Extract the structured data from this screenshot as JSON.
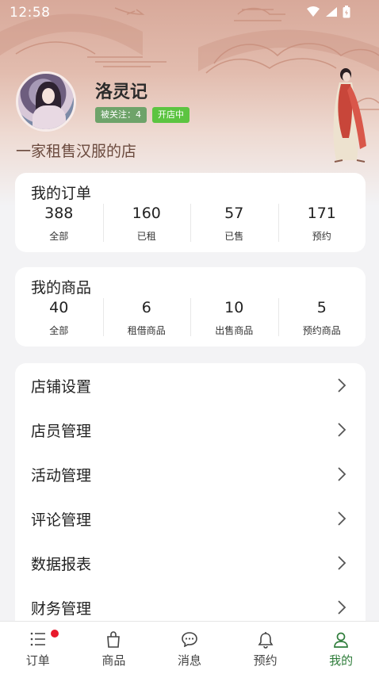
{
  "status_bar": {
    "time": "12:58"
  },
  "profile": {
    "name": "洛灵记",
    "follow_badge": "被关注：4",
    "open_badge": "开店中",
    "slogan": "一家租售汉服的店"
  },
  "orders": {
    "title": "我的订单",
    "items": [
      {
        "value": "388",
        "label": "全部"
      },
      {
        "value": "160",
        "label": "已租"
      },
      {
        "value": "57",
        "label": "已售"
      },
      {
        "value": "171",
        "label": "预约"
      }
    ]
  },
  "products": {
    "title": "我的商品",
    "items": [
      {
        "value": "40",
        "label": "全部"
      },
      {
        "value": "6",
        "label": "租借商品"
      },
      {
        "value": "10",
        "label": "出售商品"
      },
      {
        "value": "5",
        "label": "预约商品"
      }
    ]
  },
  "menu": [
    {
      "label": "店铺设置"
    },
    {
      "label": "店员管理"
    },
    {
      "label": "活动管理"
    },
    {
      "label": "评论管理"
    },
    {
      "label": "数据报表"
    },
    {
      "label": "财务管理"
    }
  ],
  "tabbar": [
    {
      "label": "订单",
      "icon": "list-icon"
    },
    {
      "label": "商品",
      "icon": "bag-icon"
    },
    {
      "label": "消息",
      "icon": "chat-icon"
    },
    {
      "label": "预约",
      "icon": "bell-icon"
    },
    {
      "label": "我的",
      "icon": "person-icon"
    }
  ],
  "colors": {
    "accent": "#2f7d3b",
    "follow_badge": "#6ea36a",
    "open_badge": "#5cc441",
    "notification_dot": "#e8192c"
  }
}
